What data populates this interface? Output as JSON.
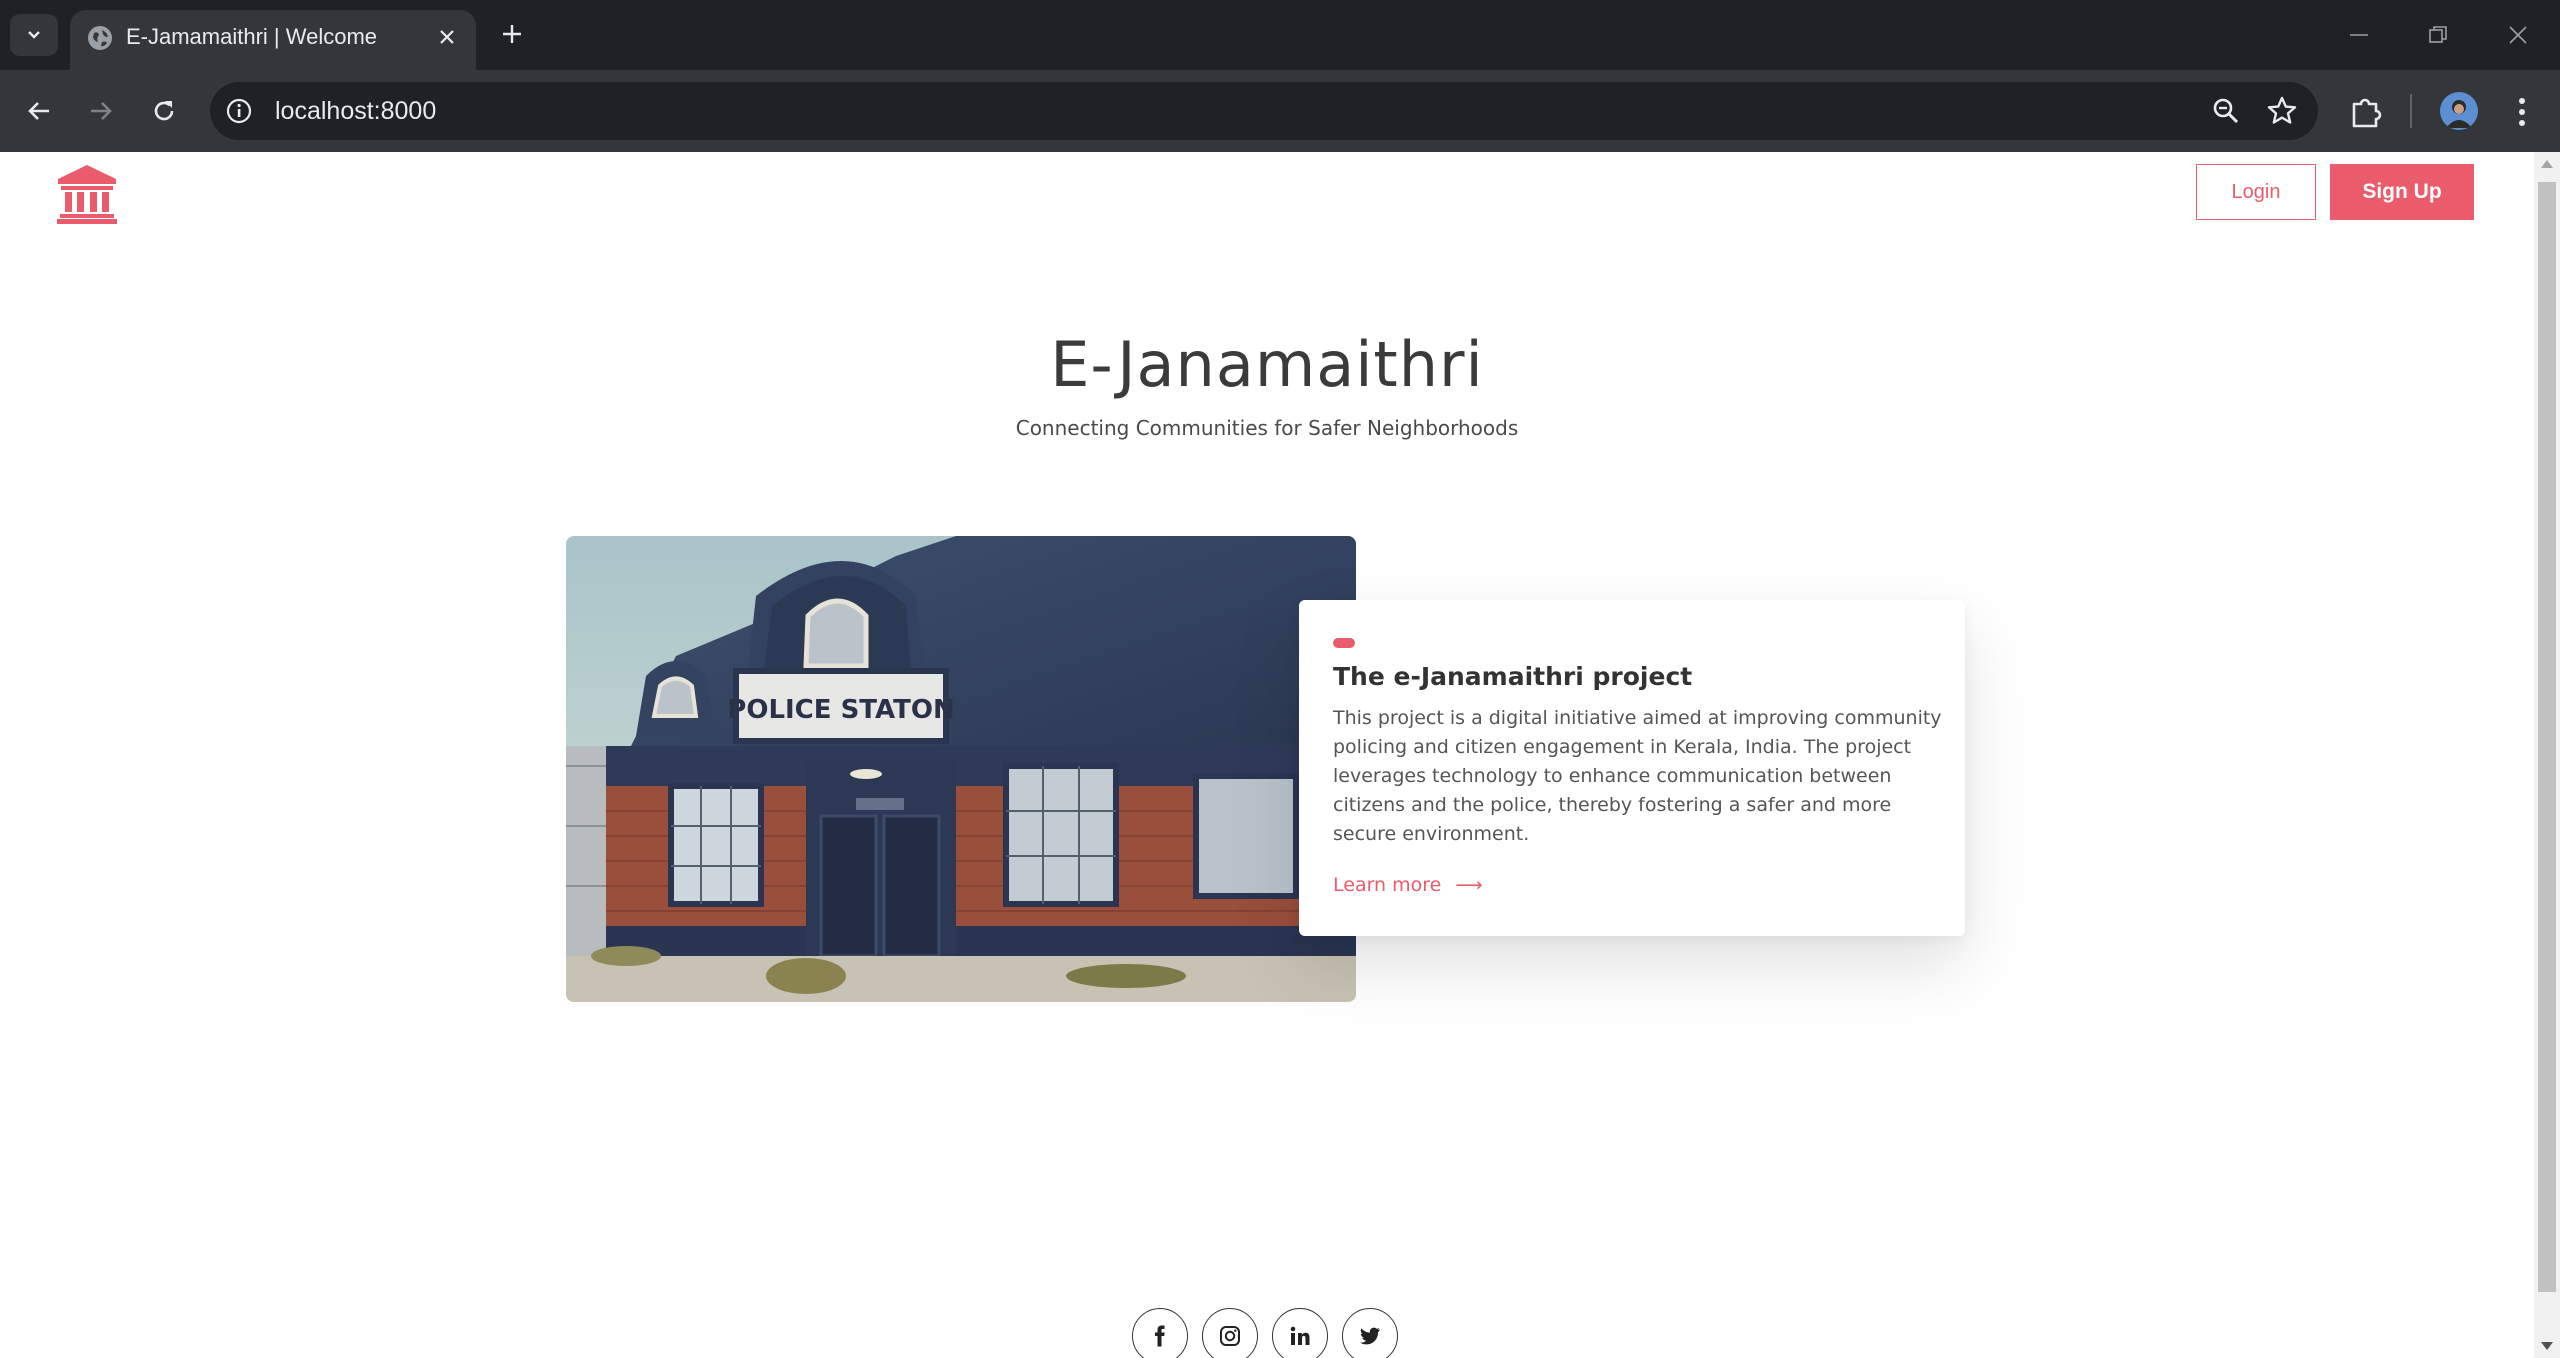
{
  "browser": {
    "tab_title": "E-Jamamaithri | Welcome",
    "url": "localhost:8000"
  },
  "nav": {
    "login_label": "Login",
    "signup_label": "Sign Up",
    "logo_icon": "bank-building-icon"
  },
  "hero": {
    "title": "E-Janamaithri",
    "subtitle": "Connecting Communities for Safer Neighborhoods",
    "image_sign_text": "POLICE STATON"
  },
  "card": {
    "title": "The e-Janamaithri project",
    "text": "This project is a digital initiative aimed at improving community policing and citizen engagement in Kerala, India. The project leverages technology to enhance communication between citizens and the police, thereby fostering a safer and more secure environment.",
    "link_label": "Learn more",
    "arrow": "⟶"
  },
  "social": [
    {
      "icon": "facebook-icon",
      "glyph": "f"
    },
    {
      "icon": "instagram-icon",
      "glyph": ""
    },
    {
      "icon": "linkedin-icon",
      "glyph": "in"
    },
    {
      "icon": "twitter-icon",
      "glyph": ""
    }
  ],
  "colors": {
    "accent": "#ea5b6b",
    "chrome_dark": "#202124",
    "chrome_toolbar": "#35363a"
  }
}
